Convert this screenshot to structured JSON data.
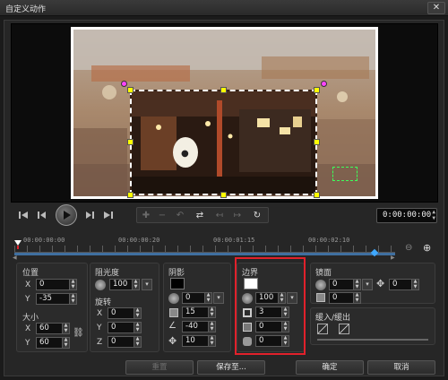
{
  "window": {
    "title": "自定义动作",
    "close_label": "✕"
  },
  "playback": {
    "timecode": "0:00:00:00"
  },
  "timeline": {
    "labels": [
      "00:00:00:00",
      "00:00:00:20",
      "00:00:01:15",
      "00:00:02:10"
    ]
  },
  "position": {
    "title": "位置",
    "x_label": "X",
    "x": "0",
    "y_label": "Y",
    "y": "-35"
  },
  "size": {
    "title": "大小",
    "x_label": "X",
    "x": "60",
    "y_label": "Y",
    "y": "60"
  },
  "opacity": {
    "title": "阻光度",
    "value": "100"
  },
  "rotation": {
    "title": "旋转",
    "x_label": "X",
    "x": "0",
    "y_label": "Y",
    "y": "0",
    "z_label": "Z",
    "z": "0"
  },
  "shadow": {
    "title": "阴影",
    "color": "#000000",
    "opacity": "0",
    "blur": "15",
    "angle": "-40",
    "distance": "10"
  },
  "border": {
    "title": "边界",
    "color": "#ffffff",
    "opacity": "100",
    "width": "3",
    "soft": "0",
    "rounded": "0"
  },
  "mirror": {
    "title": "镜面",
    "opacity": "0",
    "blur": "0",
    "distance": "0"
  },
  "ease": {
    "title": "缓入/缓出"
  },
  "buttons": {
    "reset": "重置",
    "save_as": "保存至...",
    "ok": "确定",
    "cancel": "取消"
  },
  "colors": {
    "highlight": "#e1212b",
    "handle": "#ffff00",
    "rotate_handle": "#ff44ff",
    "track": "#3f6fa0"
  }
}
